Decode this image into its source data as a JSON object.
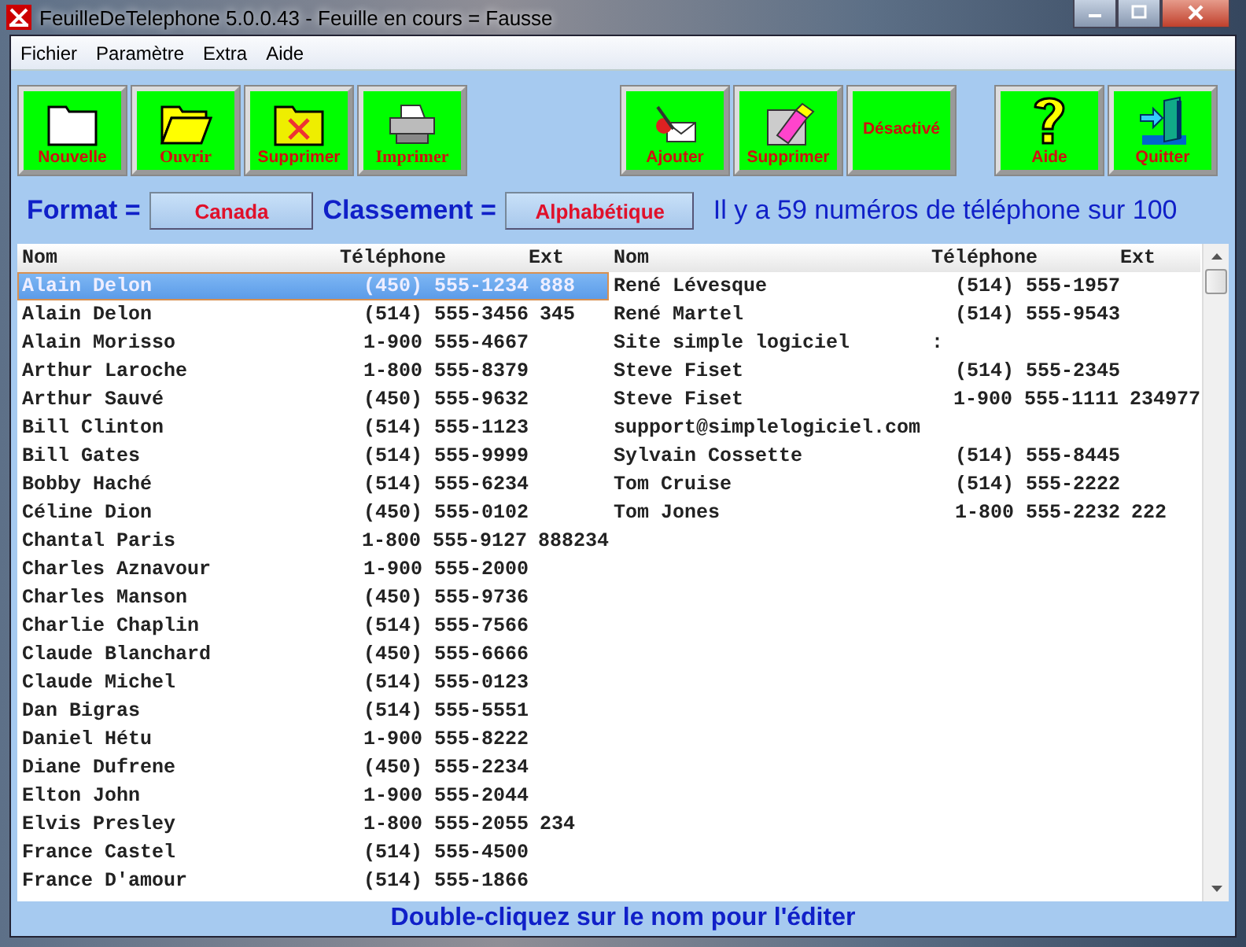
{
  "window": {
    "title": "FeuilleDeTelephone 5.0.0.43 - Feuille en cours = Fausse"
  },
  "menu": [
    "Fichier",
    "Paramètre",
    "Extra",
    "Aide"
  ],
  "toolbar": [
    {
      "buttons": [
        {
          "label": "Nouvelle",
          "kind": "new"
        },
        {
          "label": "Ouvrir",
          "kind": "open"
        },
        {
          "label": "Supprimer",
          "kind": "delete-file"
        },
        {
          "label": "Imprimer",
          "kind": "print"
        }
      ]
    },
    {
      "buttons": [
        {
          "label": "Ajouter",
          "kind": "add"
        },
        {
          "label": "Supprimer",
          "kind": "erase"
        },
        {
          "label": "Désactivé",
          "kind": "text"
        }
      ]
    },
    {
      "buttons": [
        {
          "label": "Aide",
          "kind": "help"
        },
        {
          "label": "Quitter",
          "kind": "quit"
        }
      ]
    }
  ],
  "format_row": {
    "format_label": "Format =",
    "format_value": "Canada",
    "sort_label": "Classement =",
    "sort_value": "Alphabétique",
    "count": "Il y a 59 numéros de téléphone sur 100"
  },
  "panes": [
    {
      "headers": [
        "Nom",
        "Téléphone",
        "Ext"
      ],
      "rows": [
        {
          "name": "Alain Delon",
          "phone": "(450) 555-1234",
          "ext": "888",
          "selected": true
        },
        {
          "name": "Alain Delon",
          "phone": "(514) 555-3456",
          "ext": "345",
          "selected": false
        },
        {
          "name": "Alain Morisso",
          "phone": "1-900 555-4667",
          "selected": false
        },
        {
          "name": "Arthur Laroche",
          "phone": "1-800 555-8379",
          "selected": false
        },
        {
          "name": "Arthur Sauvé",
          "phone": "(450) 555-9632",
          "selected": false
        },
        {
          "name": "Bill Clinton",
          "phone": "(514) 555-1123",
          "selected": false
        },
        {
          "name": "Bill Gates",
          "phone": "(514) 555-9999",
          "selected": false
        },
        {
          "name": "Bobby Haché",
          "phone": "(514) 555-6234",
          "selected": false
        },
        {
          "name": "Céline Dion",
          "phone": "(450) 555-0102",
          "selected": false
        },
        {
          "name": "Chantal Paris",
          "phone": "1-800 555-9127",
          "ext": "888234",
          "selected": false
        },
        {
          "name": "Charles Aznavour",
          "phone": "1-900 555-2000",
          "selected": false
        },
        {
          "name": "Charles Manson",
          "phone": "(450) 555-9736",
          "selected": false
        },
        {
          "name": "Charlie Chaplin",
          "phone": "(514) 555-7566",
          "selected": false
        },
        {
          "name": "Claude Blanchard",
          "phone": "(450) 555-6666",
          "selected": false
        },
        {
          "name": "Claude Michel",
          "phone": "(514) 555-0123",
          "selected": false
        },
        {
          "name": "Dan Bigras",
          "phone": "(514) 555-5551",
          "selected": false
        },
        {
          "name": "Daniel Hétu",
          "phone": "1-900 555-8222",
          "selected": false
        },
        {
          "name": "Diane Dufrene",
          "phone": "(450) 555-2234",
          "selected": false
        },
        {
          "name": "Elton John",
          "phone": "1-900 555-2044",
          "selected": false
        },
        {
          "name": "Elvis Presley",
          "phone": "1-800 555-2055",
          "ext": "234",
          "selected": false
        },
        {
          "name": "France Castel",
          "phone": "(514) 555-4500",
          "selected": false
        },
        {
          "name": "France D'amour",
          "phone": "(514) 555-1866",
          "selected": false
        }
      ]
    },
    {
      "headers": [
        "Nom",
        "Téléphone",
        "Ext"
      ],
      "rows": [
        {
          "name": "René Lévesque",
          "phone": "(514) 555-1957",
          "selected": false
        },
        {
          "name": "René Martel",
          "phone": "(514) 555-9543",
          "selected": false
        },
        {
          "name": "Site simple logiciel",
          "phone": ":",
          "selected": false
        },
        {
          "name": "Steve Fiset",
          "phone": "(514) 555-2345",
          "selected": false
        },
        {
          "name": "Steve Fiset",
          "phone": "1-900 555-1111",
          "ext": "234977",
          "selected": false
        },
        {
          "name": "support@simplelogiciel.com",
          "selected": false
        },
        {
          "name": "Sylvain Cossette",
          "phone": "(514) 555-8445",
          "selected": false
        },
        {
          "name": "Tom Cruise",
          "phone": "(514) 555-2222",
          "selected": false
        },
        {
          "name": "Tom Jones",
          "phone": "1-800 555-2232",
          "ext": "222",
          "selected": false
        }
      ]
    }
  ],
  "status_bar": "Double-cliquez sur le nom pour l'éditer"
}
